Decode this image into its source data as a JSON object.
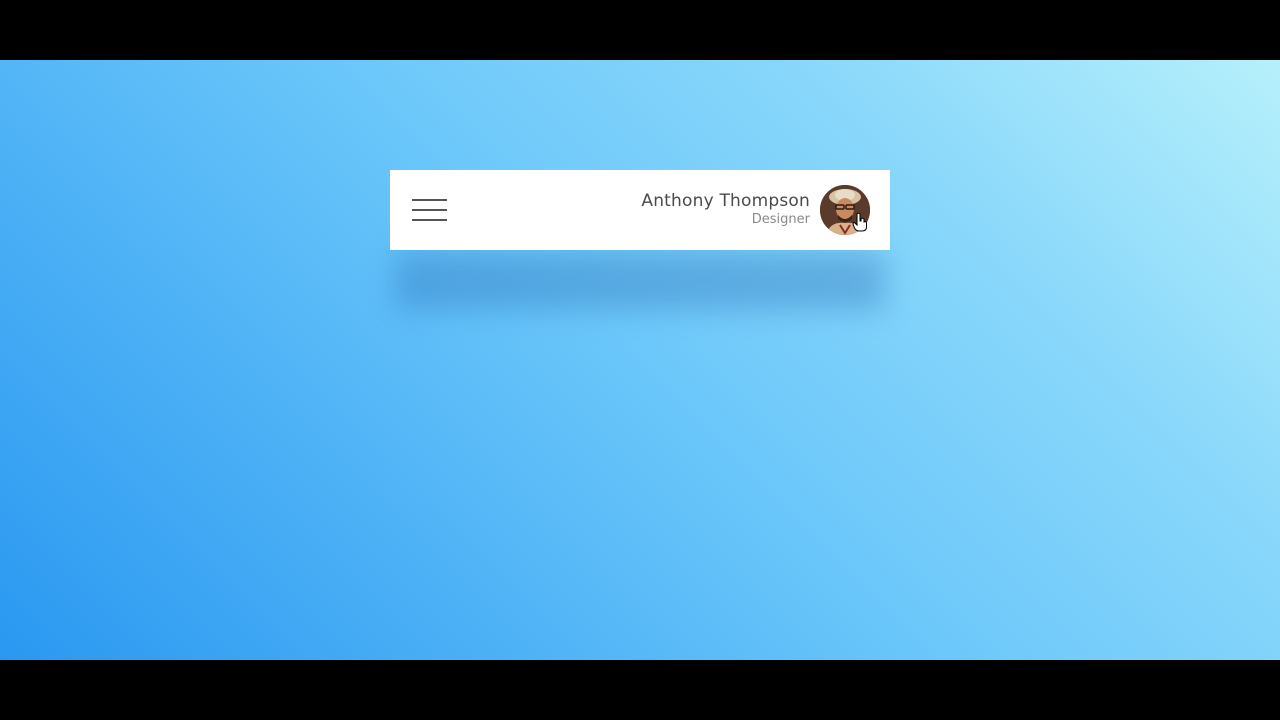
{
  "header": {
    "menu_icon": "hamburger-menu-icon",
    "user": {
      "name": "Anthony Thompson",
      "role": "Designer",
      "avatar_icon": "user-avatar-photo"
    }
  },
  "colors": {
    "background_gradient_start": "#2a98f1",
    "background_gradient_end": "#b6f0fb",
    "card_background": "#ffffff",
    "name_text": "#4a4a4a",
    "role_text": "#8a8a8a",
    "menu_bar": "#555555"
  }
}
